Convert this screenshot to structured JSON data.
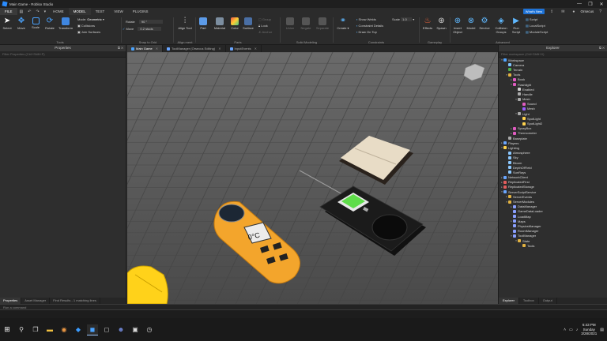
{
  "window": {
    "title": "Main Game - Roblox Studio",
    "controls": [
      "—",
      "❐",
      "✕"
    ]
  },
  "menubar": {
    "file": "FILE",
    "tabs": [
      "HOME",
      "MODEL",
      "TEST",
      "VIEW",
      "PLUGINS"
    ],
    "active_tab": "MODEL",
    "whats_new": "What's New",
    "username": "Orsecus"
  },
  "ribbon": {
    "tools": {
      "buttons": [
        "Select",
        "Move",
        "Scale",
        "Rotate",
        "Transform"
      ],
      "mode_label": "Mode:",
      "mode_value": "Geometric",
      "collisions": "Collisions",
      "join_surfaces": "Join Surfaces",
      "label": "Tools"
    },
    "snap": {
      "rotate_label": "Rotate",
      "rotate_value": "90 °",
      "move_label": "Move",
      "move_value": "0.2 studs",
      "label": "Snap to Grid"
    },
    "align": {
      "button": "Align Tool",
      "label": "Align ment"
    },
    "parts": {
      "buttons": [
        "Part",
        "Material",
        "Color",
        "Surface"
      ],
      "group": "Group",
      "lock": "Lock",
      "anchor": "Anchor",
      "label": "Parts"
    },
    "solid": {
      "buttons": [
        "Union",
        "Negate",
        "Separate"
      ],
      "label": "Solid Modeling"
    },
    "constraints": {
      "create": "Create",
      "show_welds": "Show Welds",
      "constraint_details": "Constraint Details",
      "draw_on_top": "Draw On Top",
      "scale_label": "Scale",
      "scale_value": "1.0",
      "label": "Constraints"
    },
    "gameplay": {
      "buttons": [
        "Effects",
        "Spawn"
      ],
      "label": "Gameplay"
    },
    "advanced": {
      "buttons": [
        "Insert Object",
        "Model",
        "Service",
        "Collision Groups",
        "Run Script"
      ],
      "script_items": [
        "Script",
        "LocalScript",
        "ModuleScript"
      ],
      "label": "Advanced"
    }
  },
  "properties": {
    "title": "Properties",
    "filter_placeholder": "Filter Properties (Ctrl+Shift+P)",
    "bottom_tabs": [
      "Properties",
      "Asset Manager",
      "Find Results - 1 matching lines"
    ]
  },
  "doc_tabs": [
    {
      "label": "Main Game",
      "active": true,
      "color": "#4aa3ff"
    },
    {
      "label": "ToolManager (Orsecus Editing)",
      "active": false,
      "color": "#6aa6ff"
    },
    {
      "label": "InputEvents",
      "active": false,
      "color": "#6aa6ff"
    }
  ],
  "viewport": {
    "thermometer_display": "0°C",
    "colors": {
      "thermometer_body": "#f3a52c",
      "device_body": "#1b1b1b",
      "device_screen": "#5fdd4a",
      "book_pages": "#e8dcc6",
      "glove": "#ffd21a",
      "floor": "#5b5b5b"
    }
  },
  "explorer": {
    "title": "Explorer",
    "filter_placeholder": "Filter workspace (Ctrl+Shift+X)",
    "tree": [
      {
        "label": "Workspace",
        "depth": 0,
        "expanded": true,
        "icon": "#4fa3ff"
      },
      {
        "label": "Camera",
        "depth": 1,
        "icon": "#7fc4ff"
      },
      {
        "label": "Terrain",
        "depth": 1,
        "icon": "#4bb34b"
      },
      {
        "label": "Tools",
        "depth": 1,
        "expanded": true,
        "icon": "#e3b341"
      },
      {
        "label": "Book",
        "depth": 2,
        "expanded": false,
        "icon": "#e05cc0"
      },
      {
        "label": "Flashlight",
        "depth": 2,
        "expanded": true,
        "icon": "#e05cc0"
      },
      {
        "label": "Enabled",
        "depth": 3,
        "icon": "#d0d0d0"
      },
      {
        "label": "Handle",
        "depth": 3,
        "icon": "#aaaaaa"
      },
      {
        "label": "Mesh",
        "depth": 3,
        "expanded": true,
        "icon": "#aaaaaa"
      },
      {
        "label": "Sound",
        "depth": 4,
        "icon": "#e05cc0"
      },
      {
        "label": "Mesh",
        "depth": 4,
        "icon": "#9a5cff"
      },
      {
        "label": "Light",
        "depth": 3,
        "expanded": true,
        "icon": "#aaaaaa"
      },
      {
        "label": "SpotLight",
        "depth": 4,
        "icon": "#ffd34d"
      },
      {
        "label": "SpotLight2",
        "depth": 4,
        "icon": "#ffd34d"
      },
      {
        "label": "SprayBox",
        "depth": 2,
        "expanded": false,
        "icon": "#e05cc0"
      },
      {
        "label": "Thermometer",
        "depth": 2,
        "expanded": false,
        "icon": "#e05cc0"
      },
      {
        "label": "Baseplate",
        "depth": 1,
        "icon": "#aaaaaa"
      },
      {
        "label": "Players",
        "depth": 0,
        "expanded": false,
        "icon": "#6aa6ff"
      },
      {
        "label": "Lighting",
        "depth": 0,
        "expanded": true,
        "icon": "#ffd34d"
      },
      {
        "label": "Atmosphere",
        "depth": 1,
        "icon": "#8cc8ff"
      },
      {
        "label": "Sky",
        "depth": 1,
        "icon": "#8cc8ff"
      },
      {
        "label": "Bloom",
        "depth": 1,
        "icon": "#8cc8ff"
      },
      {
        "label": "DepthOfField",
        "depth": 1,
        "icon": "#8cc8ff"
      },
      {
        "label": "SunRays",
        "depth": 1,
        "icon": "#8cc8ff"
      },
      {
        "label": "NetworkClient",
        "depth": 0,
        "expanded": false,
        "icon": "#6aa6ff"
      },
      {
        "label": "ReplicatedFirst",
        "depth": 0,
        "expanded": false,
        "icon": "#e35d5d"
      },
      {
        "label": "ReplicatedStorage",
        "depth": 0,
        "expanded": false,
        "icon": "#e35d5d"
      },
      {
        "label": "ServerScriptService",
        "depth": 0,
        "expanded": true,
        "icon": "#6aa6ff"
      },
      {
        "label": "ServerEvents",
        "depth": 1,
        "expanded": false,
        "icon": "#e3b341"
      },
      {
        "label": "ServerModules",
        "depth": 1,
        "expanded": true,
        "icon": "#e3b341"
      },
      {
        "label": "DataManager",
        "depth": 2,
        "expanded": false,
        "icon": "#8aa0ff"
      },
      {
        "label": "GameDataLoader",
        "depth": 2,
        "icon": "#8aa0ff"
      },
      {
        "label": "LoadMap",
        "depth": 2,
        "icon": "#8aa0ff"
      },
      {
        "label": "Maps",
        "depth": 2,
        "expanded": false,
        "icon": "#8aa0ff"
      },
      {
        "label": "PhysicsManager",
        "depth": 2,
        "icon": "#8aa0ff"
      },
      {
        "label": "RoomManager",
        "depth": 2,
        "icon": "#8aa0ff"
      },
      {
        "label": "ToolManager",
        "depth": 2,
        "expanded": true,
        "icon": "#8aa0ff"
      },
      {
        "label": "State",
        "depth": 3,
        "expanded": true,
        "icon": "#e3b341"
      },
      {
        "label": "Tools",
        "depth": 4,
        "icon": "#e3b341"
      }
    ],
    "bottom_tabs": [
      "Explorer",
      "Toolbox",
      "Output"
    ]
  },
  "command_bar": {
    "placeholder": "Run a command"
  },
  "taskbar": {
    "time": "6:43 PM",
    "day": "Sunday",
    "date": "3/28/2021"
  }
}
